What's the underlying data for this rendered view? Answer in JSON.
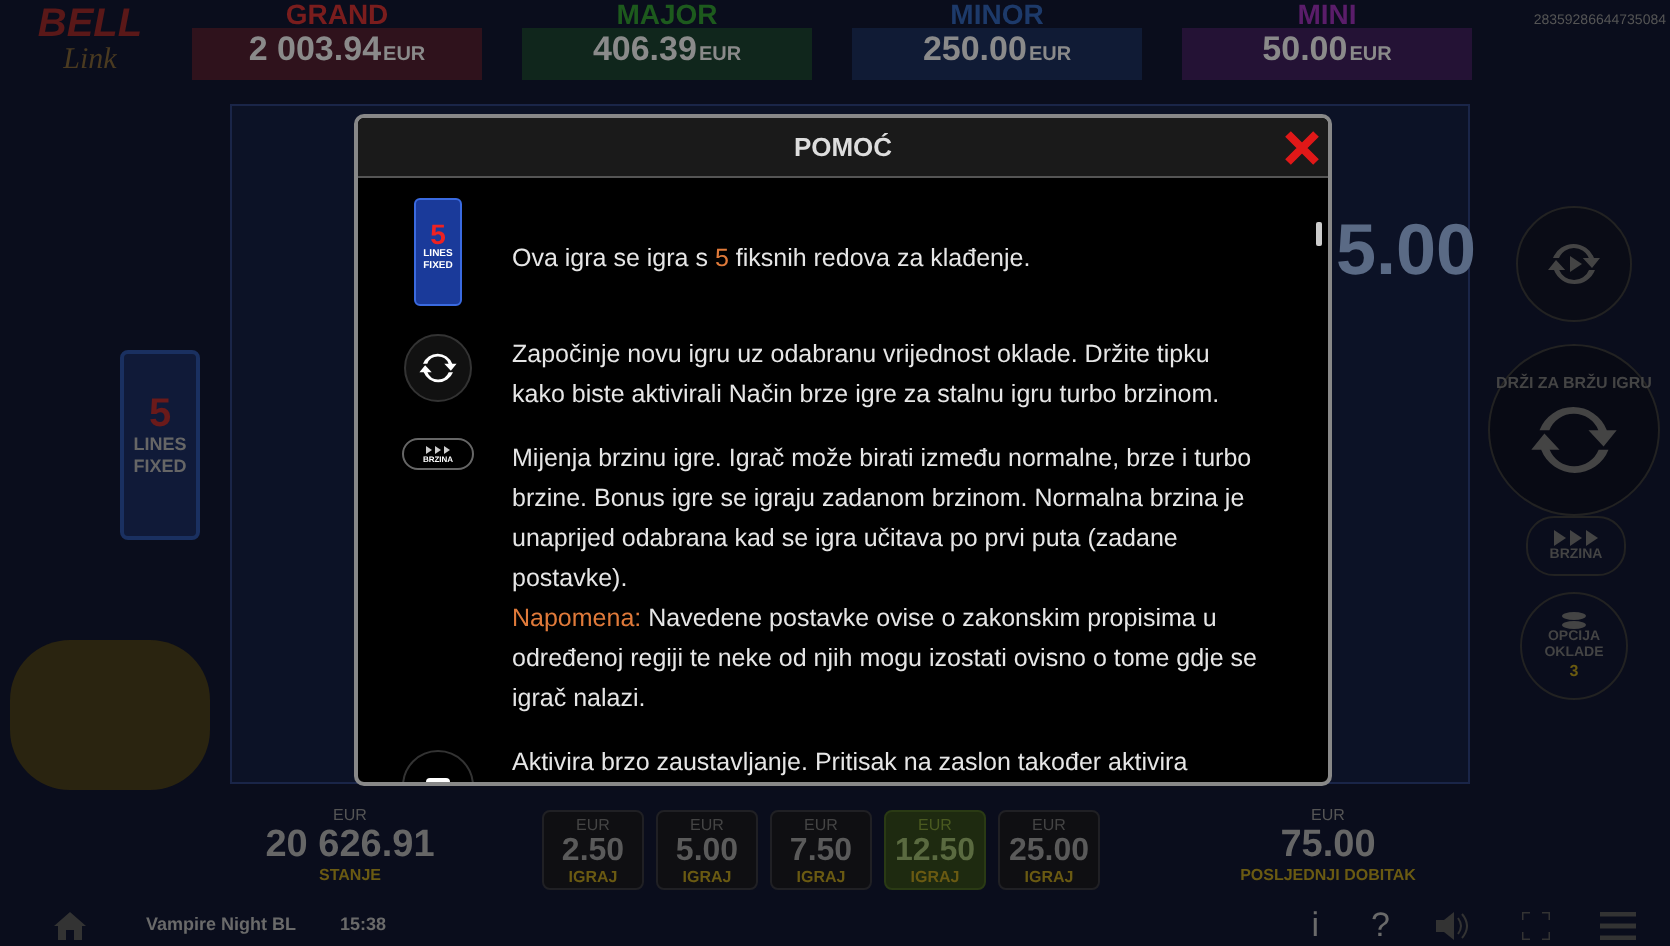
{
  "logo": {
    "line1": "BELL",
    "line2": "Link"
  },
  "jackpots": [
    {
      "name": "GRAND",
      "amount": "2 003.94",
      "currency": "EUR",
      "color": "#7a1d1d"
    },
    {
      "name": "MAJOR",
      "amount": "406.39",
      "currency": "EUR",
      "color": "#1d5a1d"
    },
    {
      "name": "MINOR",
      "amount": "250.00",
      "currency": "EUR",
      "color": "#1d3a6a"
    },
    {
      "name": "MINI",
      "amount": "50.00",
      "currency": "EUR",
      "color": "#5a1d6a"
    }
  ],
  "session_id": "28359286644735084",
  "background_win": "5.00",
  "lines_panel": {
    "number": "5",
    "line1": "LINES",
    "line2": "FIXED"
  },
  "side_controls": {
    "turbo_label": "DRŽI ZA BRŽU IGRU",
    "speed_label": "BRZINA",
    "bet_option_label": "OPCIJA",
    "bet_option_label2": "OKLADE",
    "bet_option_value": "3"
  },
  "help": {
    "title": "POMOĆ",
    "items": [
      {
        "kind": "lines",
        "icon_number": "5",
        "icon_line1": "LINES",
        "icon_line2": "FIXED",
        "parts": [
          {
            "text": "Ova igra se igra s ",
            "accent": false
          },
          {
            "text": "5",
            "accent": true
          },
          {
            "text": " fiksnih redova za klađenje.",
            "accent": false
          }
        ]
      },
      {
        "kind": "spin",
        "parts": [
          {
            "text": "Započinje novu igru uz odabranu vrijednost oklade. Držite tipku kako biste aktivirali Način brze igre za stalnu igru turbo brzinom.",
            "accent": false
          }
        ]
      },
      {
        "kind": "speed",
        "icon_label": "BRZINA",
        "parts": [
          {
            "text": "Mijenja brzinu igre. Igrač može birati između normalne, brze i turbo brzine. Bonus igre se igraju zadanom brzinom. Normalna brzina je unaprijed odabrana kad se igra učitava po prvi puta (zadane postavke).",
            "accent": false
          },
          {
            "text": "\nNapomena:",
            "accent": true
          },
          {
            "text": " Navedene postavke ovise o zakonskim propisima u određenoj regiji te neke od njih mogu izostati ovisno o tome gdje se igrač nalazi.",
            "accent": false
          }
        ]
      },
      {
        "kind": "stop",
        "parts": [
          {
            "text": "Aktivira brzo zaustavljanje. Pritisak na zaslon također aktivira",
            "accent": false
          }
        ]
      }
    ]
  },
  "balance": {
    "currency": "EUR",
    "amount": "20 626.91",
    "label": "STANJE"
  },
  "bets": [
    {
      "currency": "EUR",
      "amount": "2.50",
      "label": "IGRAJ",
      "selected": false
    },
    {
      "currency": "EUR",
      "amount": "5.00",
      "label": "IGRAJ",
      "selected": false
    },
    {
      "currency": "EUR",
      "amount": "7.50",
      "label": "IGRAJ",
      "selected": false
    },
    {
      "currency": "EUR",
      "amount": "12.50",
      "label": "IGRAJ",
      "selected": true
    },
    {
      "currency": "EUR",
      "amount": "25.00",
      "label": "IGRAJ",
      "selected": false
    }
  ],
  "last_win": {
    "currency": "EUR",
    "amount": "75.00",
    "label": "POSLJEDNJI DOBITAK"
  },
  "footer": {
    "game_name": "Vampire Night BL",
    "time": "15:38",
    "info": "i",
    "help": "?"
  }
}
